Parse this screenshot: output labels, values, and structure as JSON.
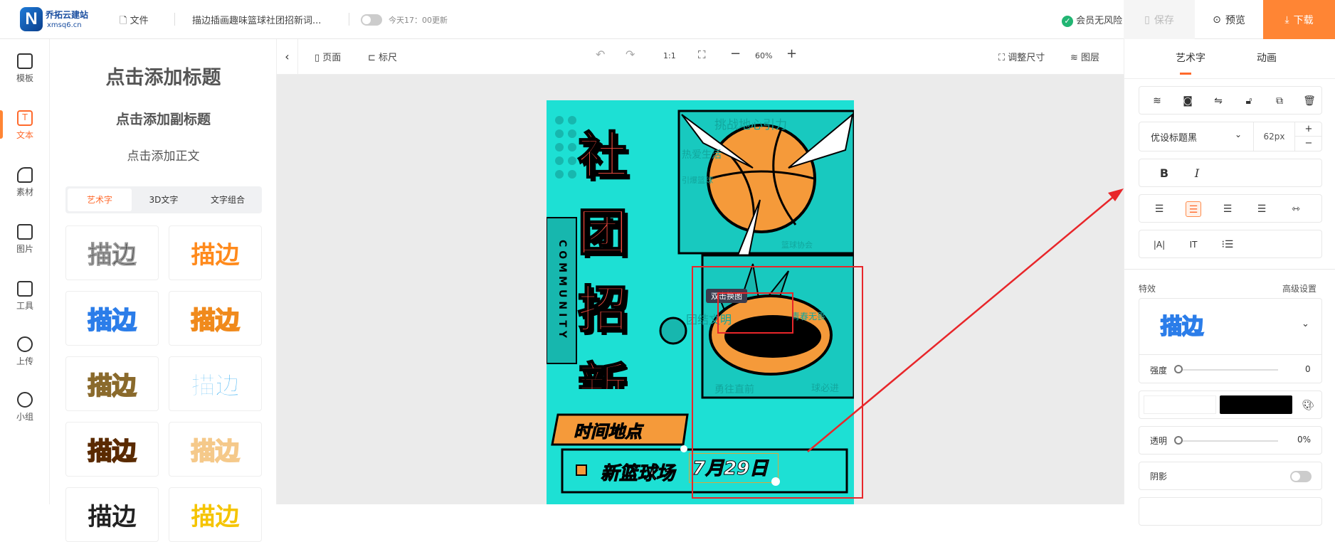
{
  "header": {
    "logo_name": "乔拓云建站",
    "logo_domain": "xmsq6.cn",
    "file_label": "文件",
    "doc_title": "描边插画趣味篮球社团招新词...",
    "autosave_text": "今天17：00更新",
    "member_text": "会员无风险",
    "save_label": "保存",
    "preview_label": "预览",
    "download_label": "下载"
  },
  "rail": [
    {
      "label": "模板"
    },
    {
      "label": "文本"
    },
    {
      "label": "素材"
    },
    {
      "label": "图片"
    },
    {
      "label": "工具"
    },
    {
      "label": "上传"
    },
    {
      "label": "小组"
    }
  ],
  "panel": {
    "title": "点击添加标题",
    "subtitle": "点击添加副标题",
    "body": "点击添加正文",
    "tabs": [
      "艺术字",
      "3D文字",
      "文字组合"
    ],
    "sample_text": "描边"
  },
  "toolbar": {
    "page": "页面",
    "ruler": "标尺",
    "ratio": "1:1",
    "zoom": "60%",
    "resize": "调整尺寸",
    "layers": "图层"
  },
  "poster": {
    "title_chars": [
      "社",
      "团",
      "招",
      "新"
    ],
    "vertical": "COMMUNITY",
    "time_place": "时间地点",
    "venue": "新篮球场",
    "date": "7月29日",
    "bg_words": [
      "挑战地心引力",
      "热爱生活",
      "引爆篮球",
      "篮球协会",
      "团结文明",
      "青春无畏",
      "勇往直前",
      "球必进"
    ],
    "tooltip": "双击换图"
  },
  "right": {
    "tabs": [
      "艺术字",
      "动画"
    ],
    "font": "优设标题黑",
    "font_size": "62px",
    "effects_label": "特效",
    "advanced_label": "高级设置",
    "effect_preview": "描边",
    "strength_label": "强度",
    "strength_value": "0",
    "opacity_label": "透明",
    "opacity_value": "0%",
    "shadow_label": "阴影",
    "colors": {
      "fill": "#ffffff",
      "stroke": "#000000"
    }
  },
  "colors": {
    "accent": "#ff6a2c",
    "download": "#ff8534",
    "poster_bg": "#1de0d4",
    "poster_red": "#f04a3e",
    "annotation": "#e8262a"
  }
}
